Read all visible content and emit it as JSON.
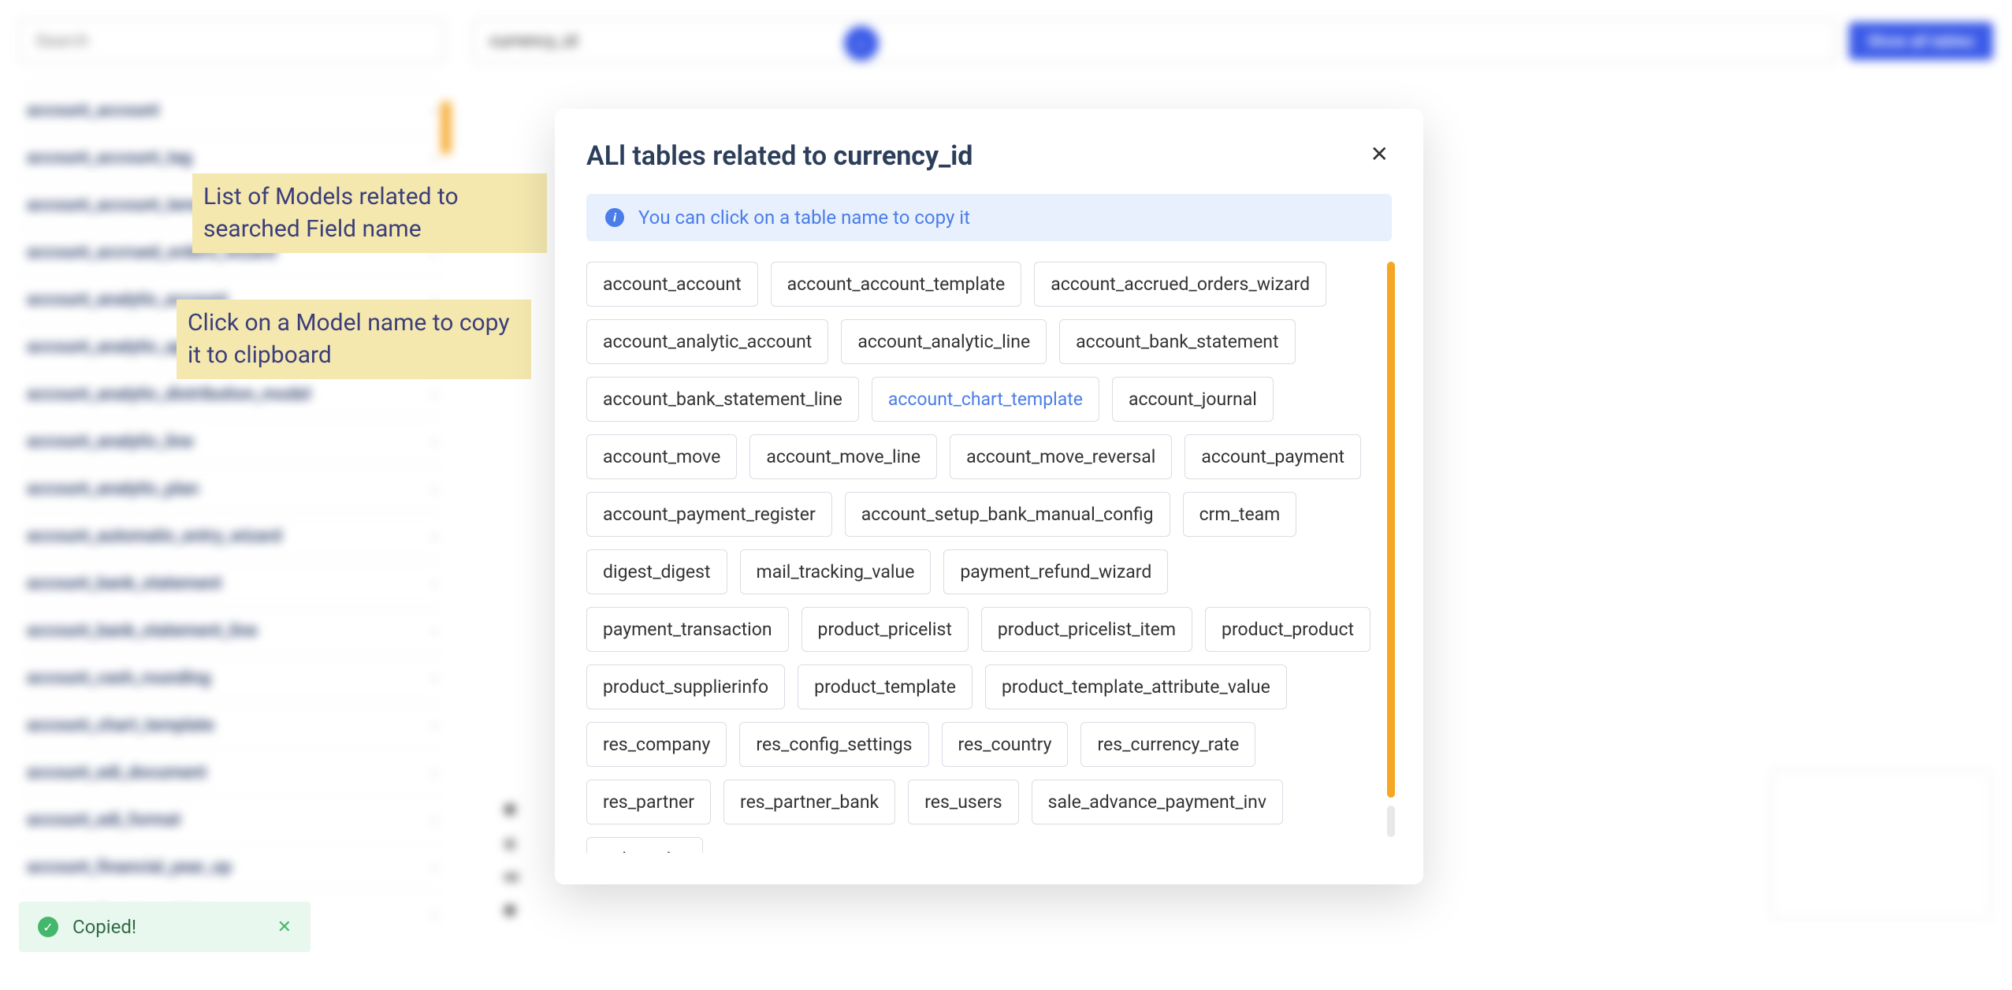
{
  "sidebar": {
    "search_placeholder": "Search",
    "models": [
      "account_account",
      "account_account_tag",
      "account_account_template",
      "account_accrued_orders_wizard",
      "account_analytic_account",
      "account_analytic_applicability",
      "account_analytic_distribution_model",
      "account_analytic_line",
      "account_analytic_plan",
      "account_automatic_entry_wizard",
      "account_bank_statement",
      "account_bank_statement_line",
      "account_cash_rounding",
      "account_chart_template",
      "account_edi_document",
      "account_edi_format",
      "account_financial_year_op",
      "account_fiscal_position"
    ]
  },
  "top_bar": {
    "search_value": "currency_id",
    "show_all_label": "Show all tables"
  },
  "annotations": {
    "anno1": "List of Models related to searched Field name",
    "anno2": "Click on a Model name to copy it to clipboard"
  },
  "modal": {
    "title_prefix": "ALl tables related to ",
    "title_field": "currency_id",
    "info_text": "You can click on a table name to copy it",
    "highlighted_table": "account_chart_template",
    "tables": [
      "account_account",
      "account_account_template",
      "account_accrued_orders_wizard",
      "account_analytic_account",
      "account_analytic_line",
      "account_bank_statement",
      "account_bank_statement_line",
      "account_chart_template",
      "account_journal",
      "account_move",
      "account_move_line",
      "account_move_reversal",
      "account_payment",
      "account_payment_register",
      "account_setup_bank_manual_config",
      "crm_team",
      "digest_digest",
      "mail_tracking_value",
      "payment_refund_wizard",
      "payment_transaction",
      "product_pricelist",
      "product_pricelist_item",
      "product_product",
      "product_supplierinfo",
      "product_template",
      "product_template_attribute_value",
      "res_company",
      "res_config_settings",
      "res_country",
      "res_currency_rate",
      "res_partner",
      "res_partner_bank",
      "res_users",
      "sale_advance_payment_inv",
      "sale_order"
    ]
  },
  "toast": {
    "message": "Copied!"
  }
}
